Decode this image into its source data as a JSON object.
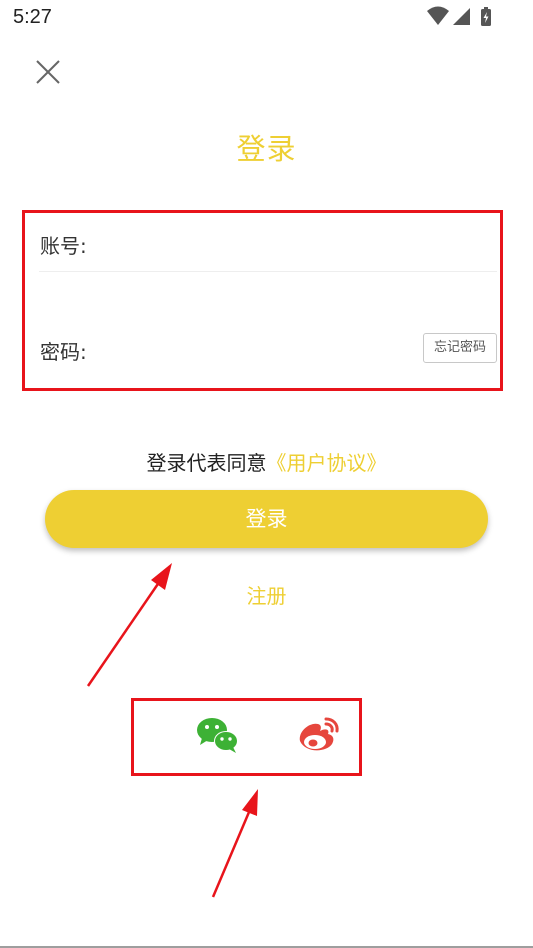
{
  "status_bar": {
    "time": "5:27",
    "icons": [
      "wifi-icon",
      "cellular-signal-icon",
      "battery-charging-icon"
    ]
  },
  "header": {
    "close_icon": "close-icon",
    "title": "登录"
  },
  "form": {
    "account_label": "账号:",
    "account_value": "",
    "password_label": "密码:",
    "password_value": "",
    "forgot_label": "忘记密码"
  },
  "agreement": {
    "text": "登录代表同意",
    "link": "《用户协议》"
  },
  "login_button": "登录",
  "register_link": "注册",
  "social": [
    {
      "name": "wechat",
      "icon": "wechat-icon",
      "color": "#3DB135"
    },
    {
      "name": "weibo",
      "icon": "weibo-icon",
      "color": "#E6463D"
    }
  ],
  "colors": {
    "accent": "#EECF33",
    "annotation": "#E8141B"
  }
}
